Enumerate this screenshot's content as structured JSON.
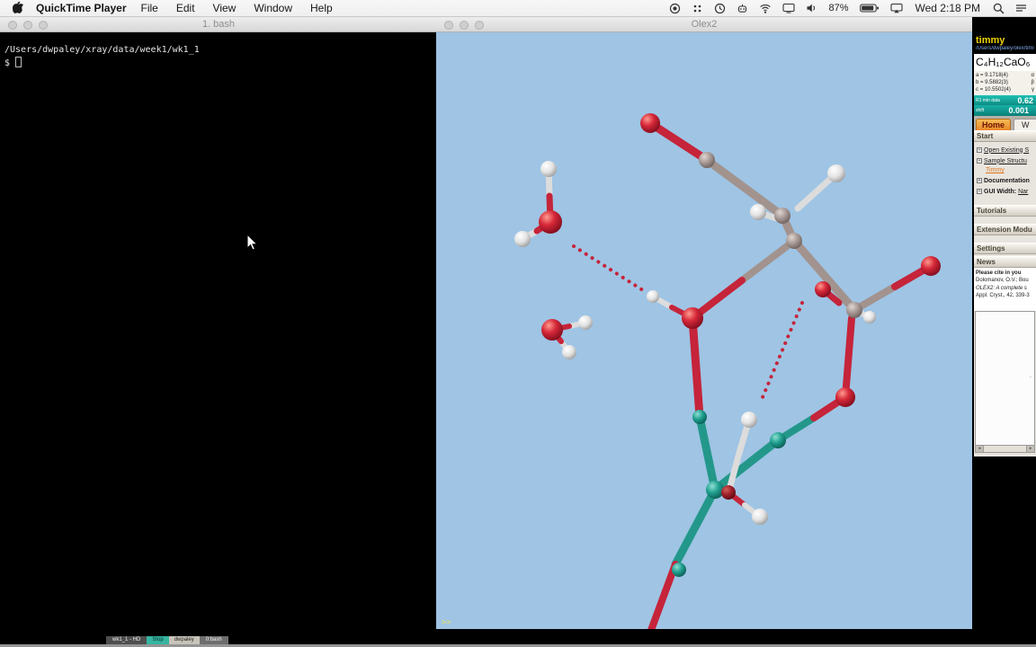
{
  "colors": {
    "viewport_background": "#9fc4e4",
    "oxygen": "#c5243a",
    "hydrogen": "#dcdcdc",
    "carbon": "#a2938e",
    "calcium": "#23988a",
    "hydrogen_bond": "#c5243a",
    "active_tab": "#f09c2c",
    "status_teal": "#12b2a8"
  },
  "menu_bar": {
    "app_name": "QuickTime Player",
    "menus": [
      "File",
      "Edit",
      "View",
      "Window",
      "Help"
    ],
    "battery": "87%",
    "clock": "Wed 2:18 PM"
  },
  "terminal": {
    "title": "1. bash",
    "cwd_line": "/Users/dwpaley/xray/data/week1/wk1_1",
    "prompt": "$"
  },
  "olex2": {
    "title": "Olex2",
    "console_prompt": ">>",
    "panel": {
      "structure_name": "timmy",
      "structure_path": "/Users/dwpaley/olex/timmy",
      "formula": "C₄H₁₂CaO₆",
      "cell": {
        "a": "a = 9.1718(4)",
        "alpha": "α",
        "b": "b = 9.5882(3)",
        "beta": "β",
        "c": "c = 10.5502(4)",
        "gamma": "γ"
      },
      "r_label": "R1 min data",
      "r_value": "0.62",
      "shift_label": "shift",
      "shift_value": "0.001",
      "tabs": {
        "home": "Home",
        "work": "W"
      },
      "sections": {
        "start": {
          "title": "Start",
          "open_existing": "Open Existing S",
          "sample": "Sample Structu",
          "sample_sub": "Timmy",
          "docs": "Documentation",
          "gui_width_label": "GUI Width:",
          "gui_width_value": "Nar"
        },
        "tutorials": "Tutorials",
        "extensions": "Extension Modu",
        "settings": "Settings",
        "news": {
          "title": "News",
          "lines": [
            "Please cite in you",
            "Dolomanov, O.V.; Bou",
            "OLEX2: A complete s",
            "Appl. Cryst., 42, 339-3"
          ]
        }
      }
    }
  },
  "bottom_bar": {
    "items": [
      "wk1_1 - HD",
      "Stop",
      "dwpaley",
      "0:bash"
    ]
  },
  "icons": {
    "scroll_left": "◂",
    "scroll_right": "▸",
    "box_dash": "-"
  }
}
